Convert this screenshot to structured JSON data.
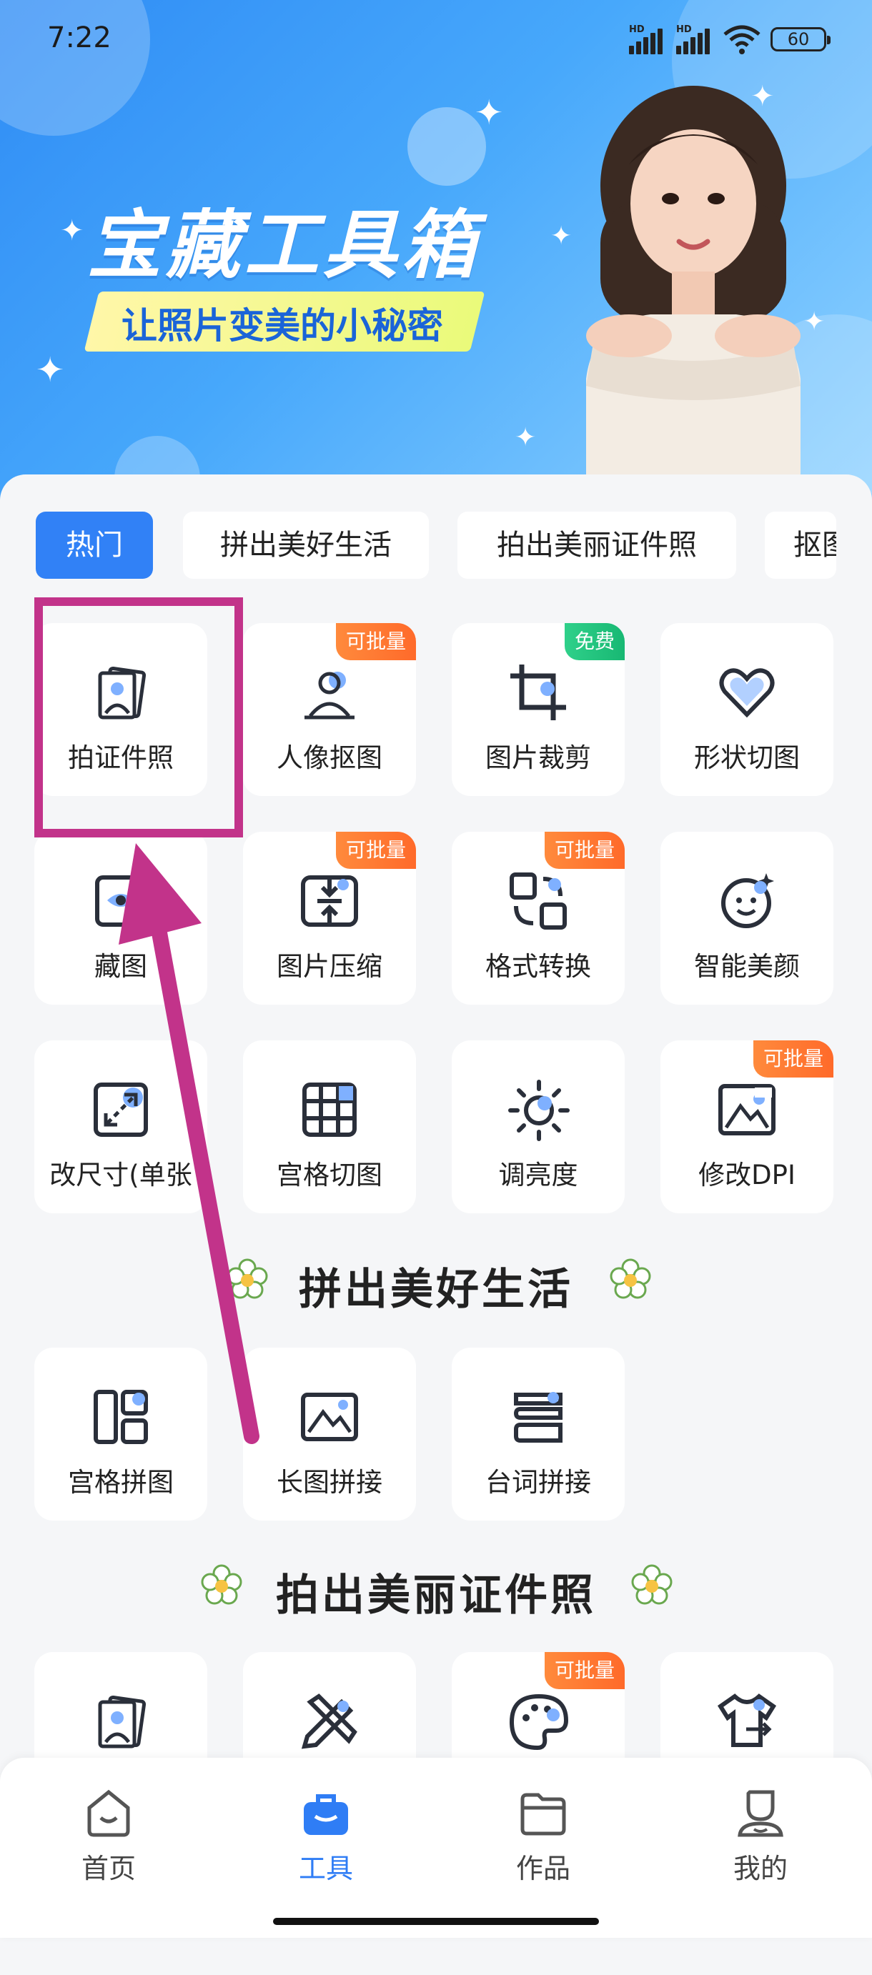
{
  "status": {
    "time": "7:22",
    "battery": "60",
    "hd": "HD"
  },
  "banner": {
    "title": "宝藏工具箱",
    "subtitle": "让照片变美的小秘密"
  },
  "tabs": [
    {
      "label": "热门",
      "active": true
    },
    {
      "label": "拼出美好生活",
      "active": false
    },
    {
      "label": "拍出美丽证件照",
      "active": false
    },
    {
      "label": "抠图",
      "active": false
    }
  ],
  "hot_tools": [
    {
      "label": "拍证件照",
      "icon": "id-photo-icon",
      "badge": ""
    },
    {
      "label": "人像抠图",
      "icon": "portrait-cutout-icon",
      "badge": "可批量"
    },
    {
      "label": "图片裁剪",
      "icon": "crop-icon",
      "badge": "免费"
    },
    {
      "label": "形状切图",
      "icon": "heart-shape-icon",
      "badge": ""
    },
    {
      "label": "藏图",
      "icon": "hide-image-icon",
      "badge": ""
    },
    {
      "label": "图片压缩",
      "icon": "compress-icon",
      "badge": "可批量"
    },
    {
      "label": "格式转换",
      "icon": "format-convert-icon",
      "badge": "可批量"
    },
    {
      "label": "智能美颜",
      "icon": "beauty-face-icon",
      "badge": ""
    },
    {
      "label": "改尺寸(单张",
      "icon": "resize-icon",
      "badge": ""
    },
    {
      "label": "宫格切图",
      "icon": "grid-cut-icon",
      "badge": ""
    },
    {
      "label": "调亮度",
      "icon": "brightness-icon",
      "badge": ""
    },
    {
      "label": "修改DPI",
      "icon": "dpi-icon",
      "badge": "可批量"
    }
  ],
  "section_life": {
    "title": "拼出美好生活",
    "tools": [
      {
        "label": "宫格拼图",
        "icon": "grid-collage-icon",
        "badge": ""
      },
      {
        "label": "长图拼接",
        "icon": "long-image-icon",
        "badge": ""
      },
      {
        "label": "台词拼接",
        "icon": "subtitle-stitch-icon",
        "badge": ""
      }
    ]
  },
  "section_id": {
    "title": "拍出美丽证件照",
    "tools": [
      {
        "label": "",
        "icon": "id-photo-icon",
        "badge": ""
      },
      {
        "label": "",
        "icon": "edit-tools-icon",
        "badge": ""
      },
      {
        "label": "",
        "icon": "palette-icon",
        "badge": "可批量"
      },
      {
        "label": "",
        "icon": "outfit-change-icon",
        "badge": ""
      }
    ]
  },
  "dpi_mark": "DPI",
  "nav": [
    {
      "label": "首页",
      "icon": "home-icon",
      "active": false
    },
    {
      "label": "工具",
      "icon": "toolbox-icon",
      "active": true
    },
    {
      "label": "作品",
      "icon": "folder-icon",
      "active": false
    },
    {
      "label": "我的",
      "icon": "profile-icon",
      "active": false
    }
  ],
  "colors": {
    "accent": "#3181f6",
    "badge_orange": "#ff7a30",
    "badge_green": "#22c27d",
    "annotation": "#c2338a"
  }
}
